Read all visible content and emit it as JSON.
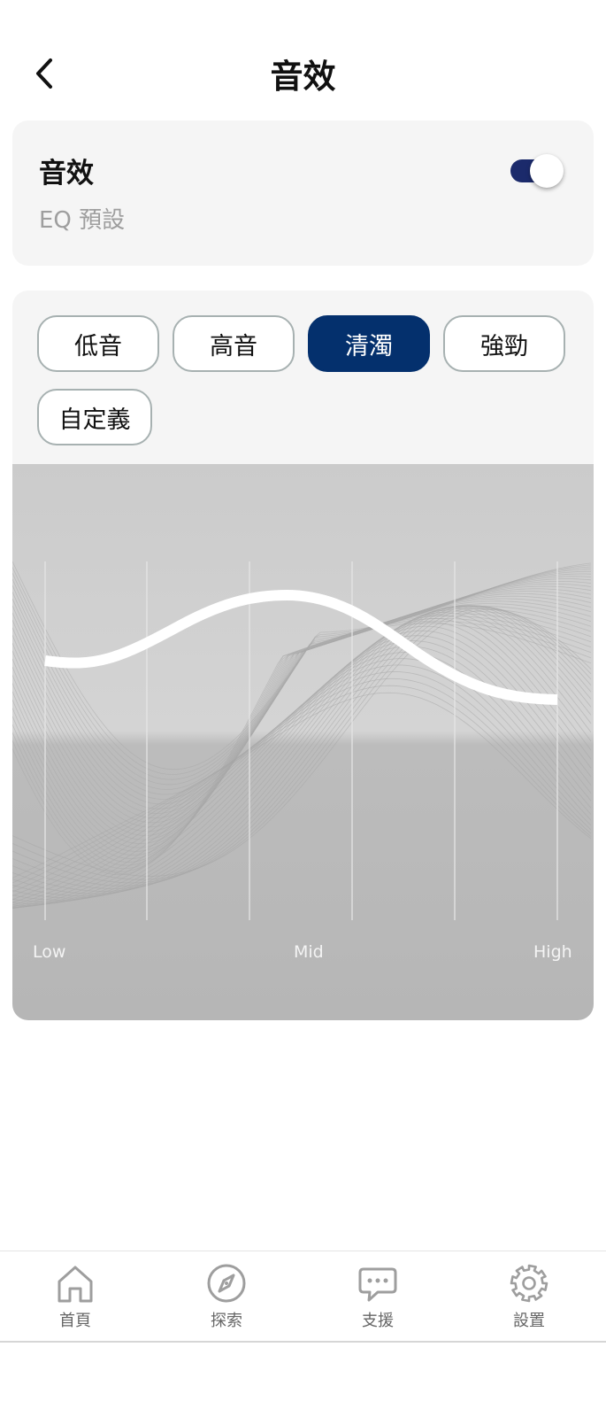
{
  "header": {
    "title": "音效",
    "back_icon": "chevron-left-icon"
  },
  "sound_card": {
    "title": "音效",
    "subtitle": "EQ 預設",
    "toggle_on": true,
    "toggle_color": "#1b2a6b"
  },
  "eq": {
    "presets": [
      {
        "label": "低音",
        "active": false
      },
      {
        "label": "高音",
        "active": false
      },
      {
        "label": "清濁",
        "active": true
      },
      {
        "label": "強勁",
        "active": false
      },
      {
        "label": "自定義",
        "active": false
      }
    ],
    "active_color": "#04306d",
    "axis_labels": {
      "low": "Low",
      "mid": "Mid",
      "high": "High"
    }
  },
  "bottom_nav": {
    "items": [
      {
        "label": "首頁",
        "icon": "home-icon"
      },
      {
        "label": "探索",
        "icon": "compass-icon"
      },
      {
        "label": "支援",
        "icon": "chat-bubble-icon"
      },
      {
        "label": "設置",
        "icon": "gear-icon"
      }
    ]
  }
}
